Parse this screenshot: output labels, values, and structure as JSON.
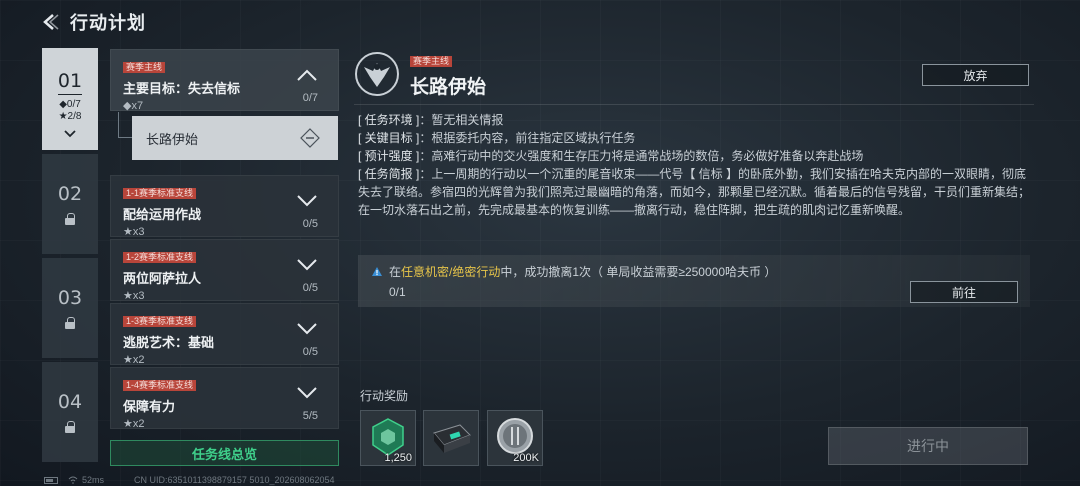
{
  "header": {
    "title": "行动计划",
    "back_icon": "back-arrow-icon"
  },
  "chapters": [
    {
      "num": "01",
      "diamond": "◆0/7",
      "star": "★2/8",
      "active": true
    },
    {
      "num": "02",
      "locked": true
    },
    {
      "num": "03",
      "locked": true
    },
    {
      "num": "04",
      "locked": true
    }
  ],
  "missions": [
    {
      "tag": "赛季主线",
      "name": "主要目标：失去信标",
      "sub": "◆x7",
      "count": "0/7",
      "expanded": true
    },
    {
      "tag": "1-1赛季标准支线",
      "name": "配给运用作战",
      "sub": "★x3",
      "count": "0/5"
    },
    {
      "tag": "1-2赛季标准支线",
      "name": "两位阿萨拉人",
      "sub": "★x3",
      "count": "0/5"
    },
    {
      "tag": "1-3赛季标准支线",
      "name": "逃脱艺术：基础",
      "sub": "★x2",
      "count": "0/5"
    },
    {
      "tag": "1-4赛季标准支线",
      "name": "保障有力",
      "sub": "★x2",
      "count": "5/5"
    }
  ],
  "sub_mission": {
    "name": "长路伊始"
  },
  "overview_label": "任务线总览",
  "detail": {
    "tag": "赛季主线",
    "title": "长路伊始",
    "abandon_label": "放弃",
    "env_label": "[ 任务环境 ]",
    "env_text": "：暂无相关情报",
    "key_label": "[ 关键目标 ]",
    "key_text": "：根据委托内容，前往指定区域执行任务",
    "intensity_label": "[ 预计强度 ]",
    "intensity_text": "：高难行动中的交火强度和生存压力将是通常战场的数倍，务必做好准备以奔赴战场",
    "brief_label": "[ 任务简报 ]",
    "brief_text": "：上一周期的行动以一个沉重的尾音收束——代号【 信标 】的卧底外勤，我们安插在哈夫克内部的一双眼睛，彻底失去了联络。参宿四的光辉曾为我们照亮过最幽暗的角落，而如今，那颗星已经沉默。循着最后的信号残留，干员们重新集结；在一切水落石出之前，先完成最基本的恢复训练——撤离行动，稳住阵脚，把生疏的肌肉记忆重新唤醒。"
  },
  "task": {
    "pre": "在",
    "highlight": "任意机密/绝密行动",
    "post": "中，成功撤离1次（ 单局收益需要≥250000哈夫币 ）",
    "progress": "0/1",
    "go_label": "前往"
  },
  "rewards": {
    "title": "行动奖励",
    "items": [
      {
        "icon": "green-token-icon",
        "amount": "1,250"
      },
      {
        "icon": "supply-case-icon",
        "amount": ""
      },
      {
        "icon": "haf-coin-icon",
        "amount": "200K"
      }
    ]
  },
  "progress_button": "进行中",
  "footer": {
    "latency": "52ms",
    "uid": "CN UID:6351011398879157 5010_202608062054"
  },
  "colors": {
    "tag_red": "#b8453a",
    "accent_green": "#3fd08b",
    "highlight_yellow": "#e7c54a"
  }
}
